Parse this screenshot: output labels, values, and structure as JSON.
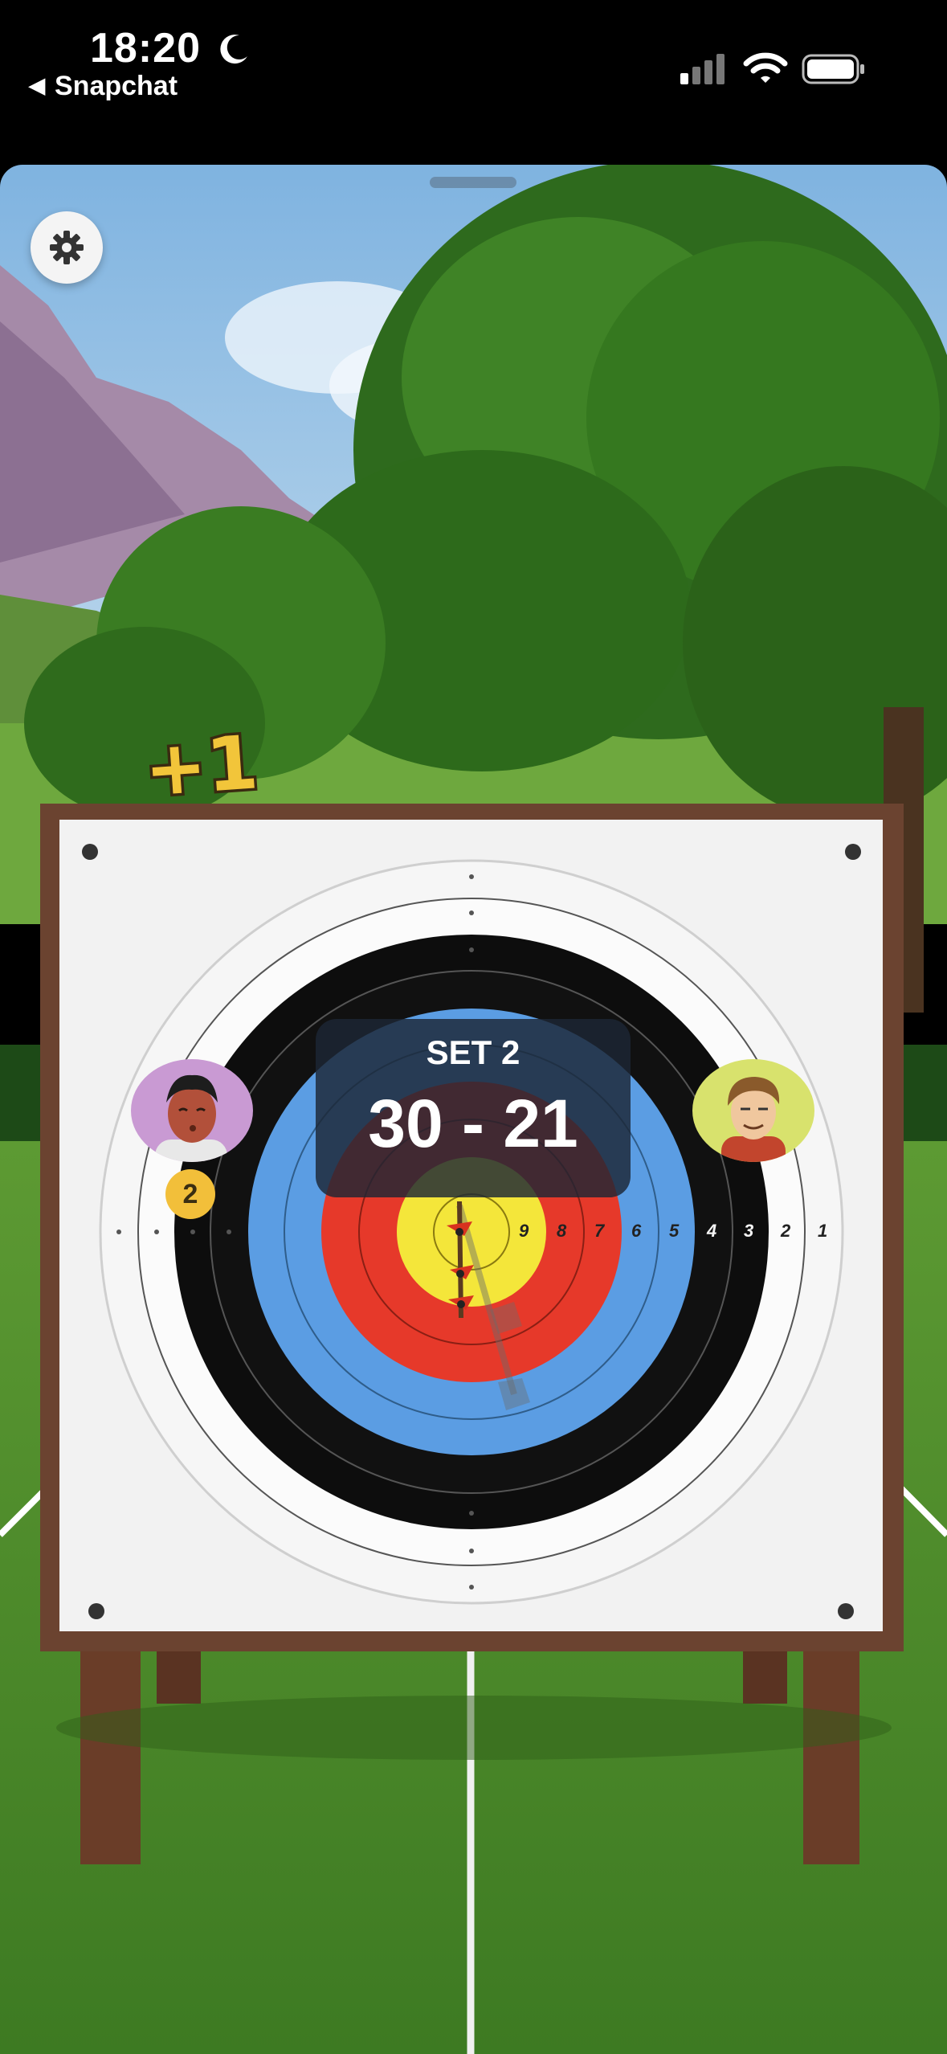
{
  "status_bar": {
    "time": "18:20",
    "back_app": "Snapchat",
    "icons": [
      "moon-icon",
      "cellular-signal-icon",
      "wifi-icon",
      "battery-icon"
    ]
  },
  "game": {
    "popup": "+1",
    "set_label": "SET 2",
    "score": "30 - 21",
    "player_left_badge": "2",
    "ring_numbers": [
      "9",
      "8",
      "7",
      "6",
      "5",
      "4",
      "3",
      "2",
      "1"
    ]
  },
  "colors": {
    "target_gold": "#f4e63a",
    "target_red": "#e6392a",
    "target_blue": "#5b9de3",
    "target_black": "#0d0d0d",
    "target_white": "#f5f5f5",
    "badge_yellow": "#f2bf3a",
    "grass": "#4f8f2a"
  }
}
